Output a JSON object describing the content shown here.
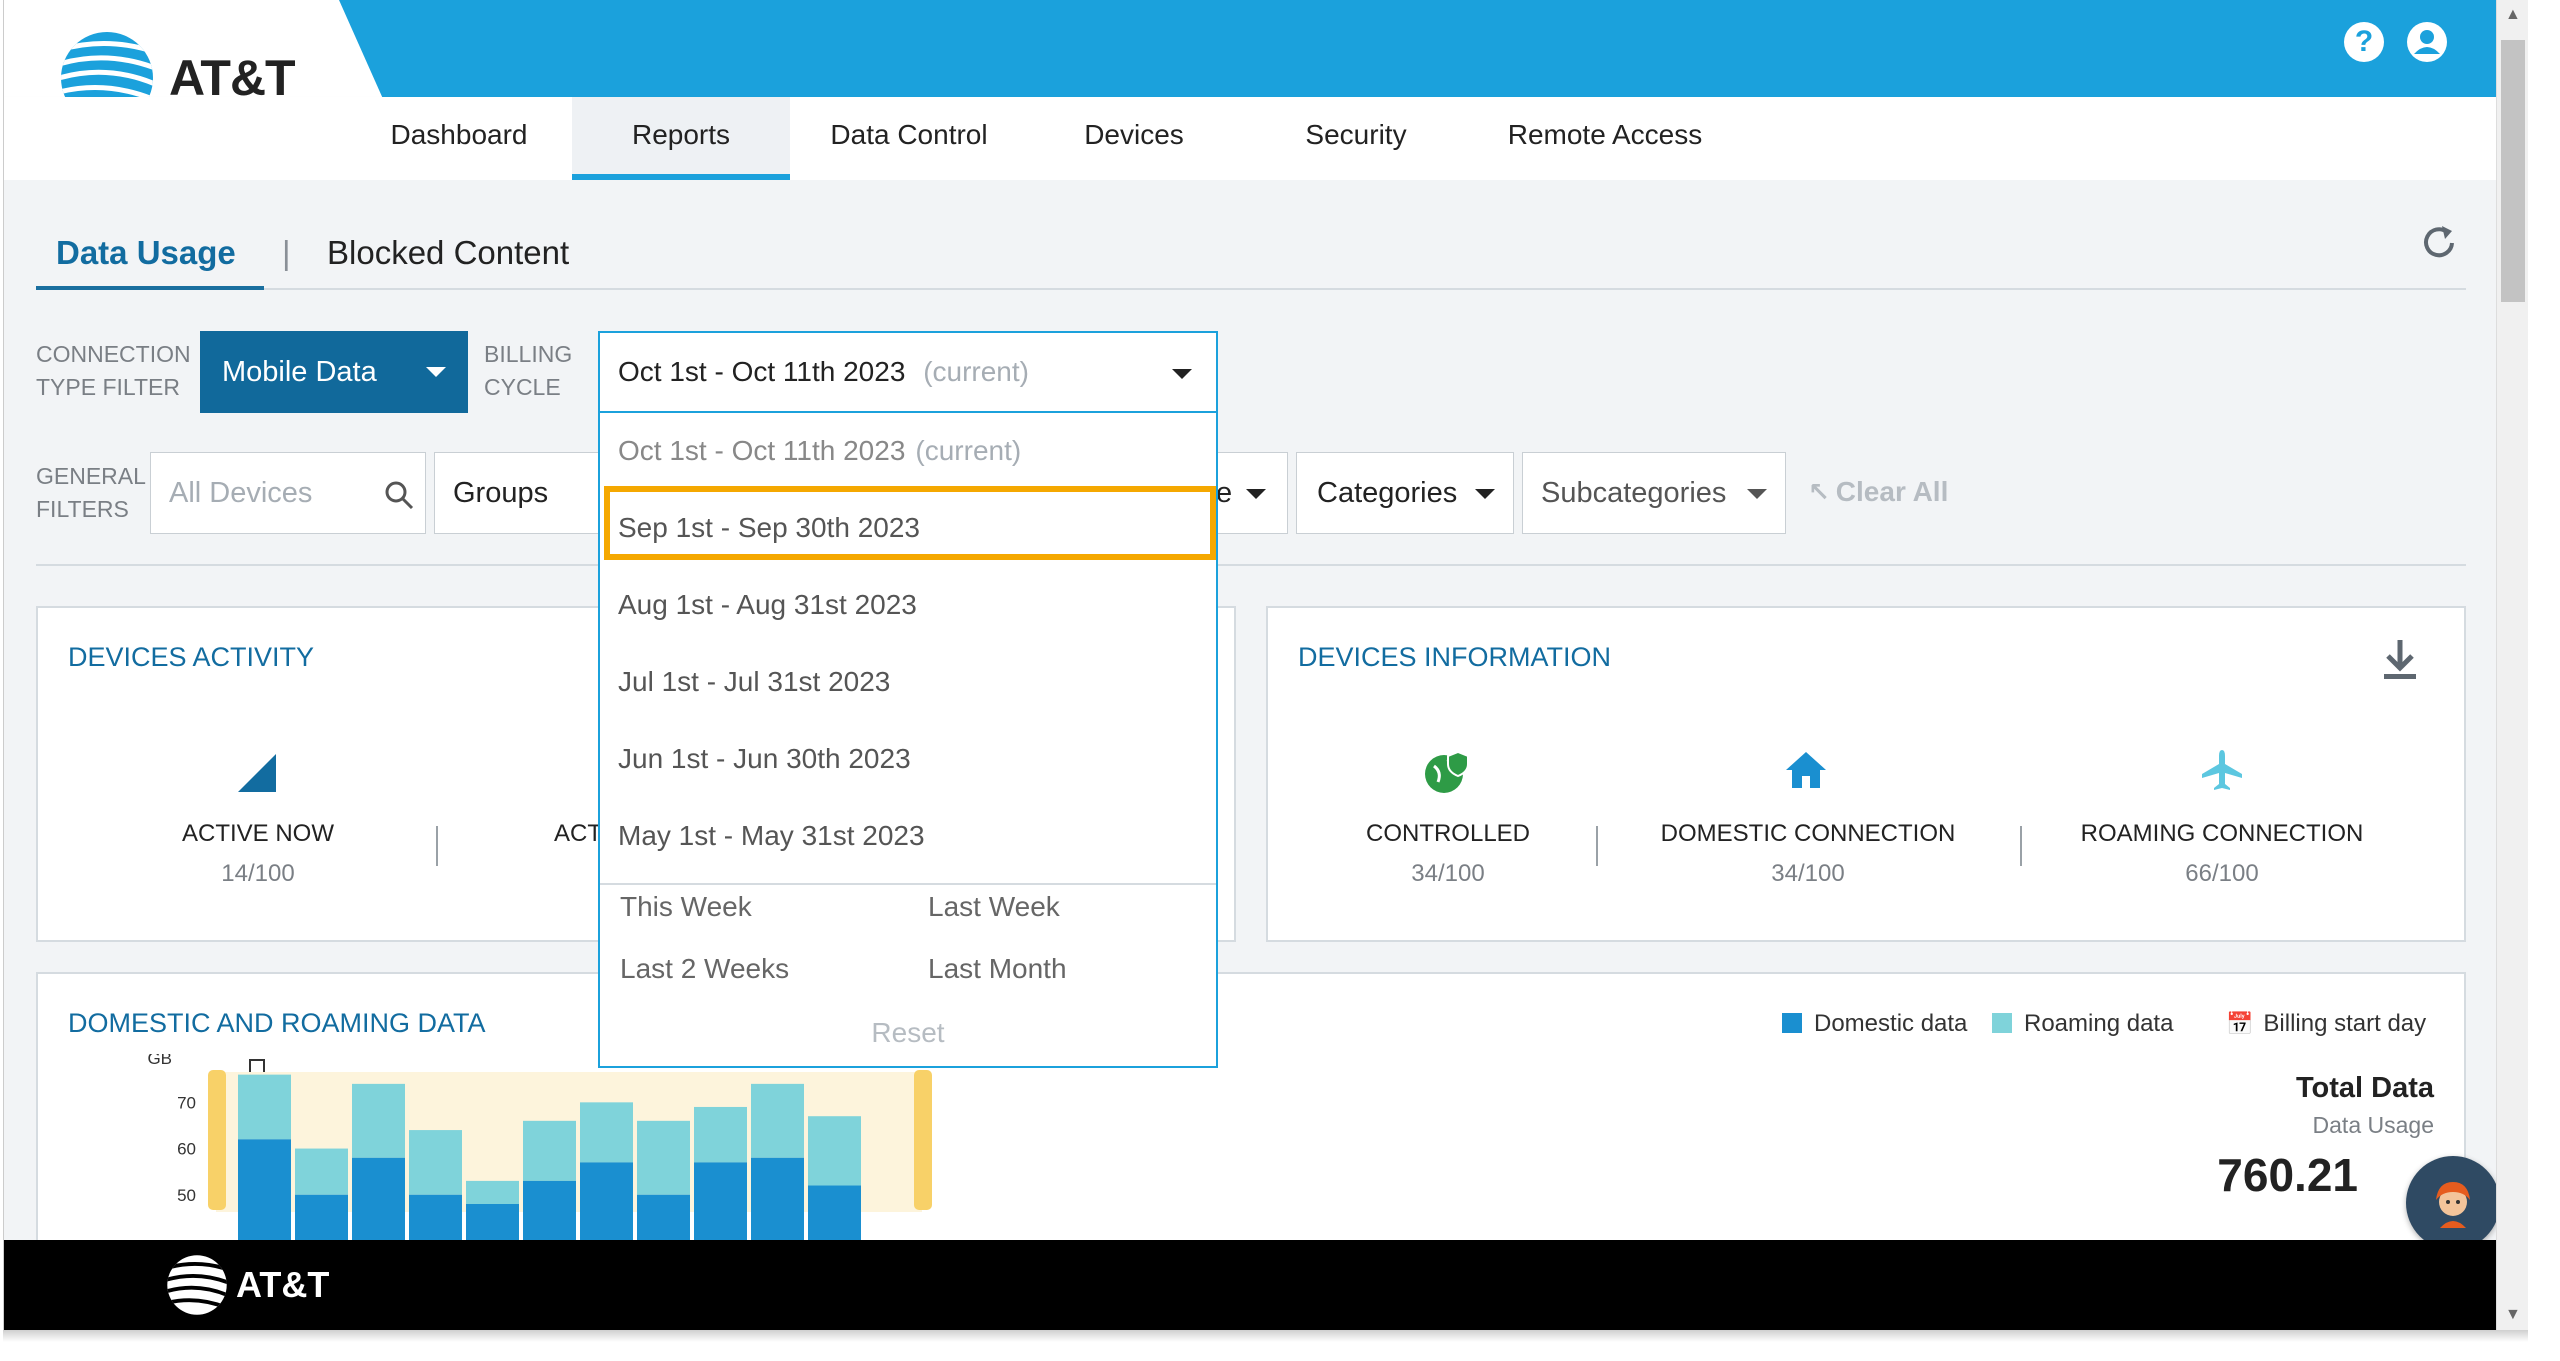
{
  "brand": {
    "name": "AT&T"
  },
  "nav": {
    "items": [
      {
        "label": "Dashboard"
      },
      {
        "label": "Reports"
      },
      {
        "label": "Data Control"
      },
      {
        "label": "Devices"
      },
      {
        "label": "Security"
      },
      {
        "label": "Remote Access"
      }
    ],
    "active": "Reports"
  },
  "header_icons": {
    "help": "?",
    "account": "user-icon"
  },
  "subtabs": {
    "data_usage": "Data Usage",
    "separator": "|",
    "blocked_content": "Blocked Content"
  },
  "filters": {
    "connection_label_1": "CONNECTION",
    "connection_label_2": "TYPE FILTER",
    "connection_value": "Mobile Data",
    "billing_label_1": "BILLING",
    "billing_label_2": "CYCLE",
    "billing_value": "Oct 1st - Oct 11th 2023",
    "billing_value_suffix": "(current)",
    "general_label_1": "GENERAL",
    "general_label_2": "FILTERS",
    "devices_placeholder": "All Devices",
    "groups": "Groups",
    "hidden_partial": "e",
    "categories": "Categories",
    "subcategories": "Subcategories",
    "clear_all": "Clear All"
  },
  "billing_menu": {
    "options": [
      {
        "label": "Oct 1st - Oct 11th 2023",
        "suffix": "(current)"
      },
      {
        "label": "Sep 1st - Sep 30th 2023",
        "suffix": ""
      },
      {
        "label": "Aug 1st - Aug 31st 2023",
        "suffix": ""
      },
      {
        "label": "Jul 1st - Jul 31st 2023",
        "suffix": ""
      },
      {
        "label": "Jun 1st - Jun 30th 2023",
        "suffix": ""
      },
      {
        "label": "May 1st - May 31st 2023",
        "suffix": ""
      }
    ],
    "highlighted": "Sep 1st - Sep 30th 2023",
    "quick": {
      "this_week": "This Week",
      "last_week": "Last Week",
      "last_2_weeks": "Last 2 Weeks",
      "last_month": "Last Month",
      "reset": "Reset"
    }
  },
  "devices_activity": {
    "title": "DEVICES ACTIVITY",
    "active_now_label": "ACTIVE NOW",
    "active_now_value": "14/100",
    "second_label_partial": "ACT"
  },
  "devices_information": {
    "title": "DEVICES INFORMATION",
    "stats": [
      {
        "label": "CONTROLLED",
        "value": "34/100",
        "icon": "globe-shield-icon",
        "color": "#2e9b46"
      },
      {
        "label": "DOMESTIC CONNECTION",
        "value": "34/100",
        "icon": "home-icon",
        "color": "#1a8fd0"
      },
      {
        "label": "ROAMING CONNECTION",
        "value": "66/100",
        "icon": "airplane-icon",
        "color": "#5cc7e0"
      }
    ]
  },
  "domestic_roaming": {
    "title": "DOMESTIC AND ROAMING DATA",
    "legend": {
      "domestic": "Domestic data",
      "roaming": "Roaming data",
      "billing_start": "Billing start day"
    },
    "total_title": "Total Data",
    "total_sub": "Data Usage",
    "total_value": "760.21"
  },
  "chart_data": {
    "type": "bar",
    "ylabel": "GB",
    "yticks": [
      50,
      60,
      70
    ],
    "ylim": [
      48,
      77
    ],
    "series": [
      {
        "name": "Domestic data",
        "color": "#1a8fd0",
        "values": [
          62,
          50,
          58,
          50,
          48,
          53,
          57,
          50,
          57,
          58,
          52
        ]
      },
      {
        "name": "Roaming data",
        "color": "#7fd3da",
        "values": [
          14,
          10,
          16,
          14,
          5,
          13,
          13,
          16,
          12,
          16,
          15
        ]
      }
    ],
    "colors": {
      "domestic": "#1a8fd0",
      "roaming": "#7fd3da",
      "range": "#fdf4dc",
      "handle": "#f8d168"
    }
  },
  "footer": {
    "brand": "AT&T"
  }
}
